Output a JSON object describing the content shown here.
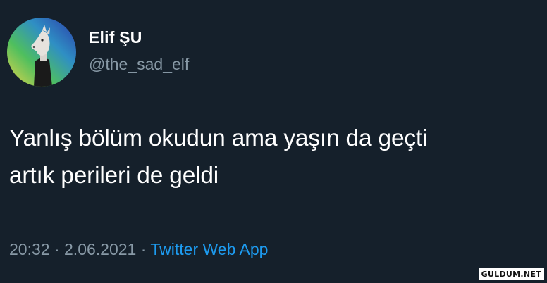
{
  "tweet": {
    "author": {
      "display_name": "Elif ŞU",
      "handle": "@the_sad_elf",
      "avatar_icon": "profile-avatar-icon"
    },
    "text_line_1": "Yanlış bölüm okudun ama yaşın da geçti",
    "text_line_2": "artık perileri de geldi",
    "time": "20:32",
    "separator": " · ",
    "date": "2.06.2021",
    "source": "Twitter Web App"
  },
  "watermark": "GULDUM.NET",
  "colors": {
    "background": "#15202b",
    "text_primary": "#ffffff",
    "text_secondary": "#8899a6",
    "link": "#1d9bf0"
  }
}
